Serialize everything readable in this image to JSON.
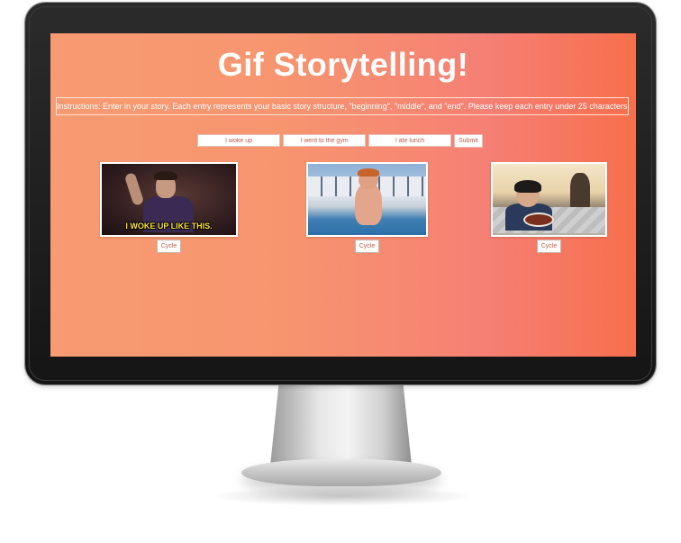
{
  "page": {
    "title": "Gif Storytelling!",
    "instructions": "Instructions: Enter in your story. Each entry represents your basic story structure, \"beginning\", \"middle\", and \"end\". Please keep each entry under 25 characters."
  },
  "form": {
    "inputs": [
      {
        "part": "beginning",
        "value": "I woke up"
      },
      {
        "part": "middle",
        "value": "I went to the gym"
      },
      {
        "part": "end",
        "value": "I ate lunch"
      }
    ],
    "submit_label": "Submit"
  },
  "gifs": [
    {
      "part": "beginning",
      "caption": "I WOKE UP LIKE THIS.",
      "cycle_label": "Cycle"
    },
    {
      "part": "middle",
      "caption": "",
      "cycle_label": "Cycle"
    },
    {
      "part": "end",
      "caption": "",
      "cycle_label": "Cycle"
    }
  ],
  "colors": {
    "gradient_start": "#f79b72",
    "gradient_end": "#f76f4c",
    "text_on_gradient": "#ffffff",
    "button_text": "#c25b4a",
    "caption_yellow": "#ffe53b"
  }
}
